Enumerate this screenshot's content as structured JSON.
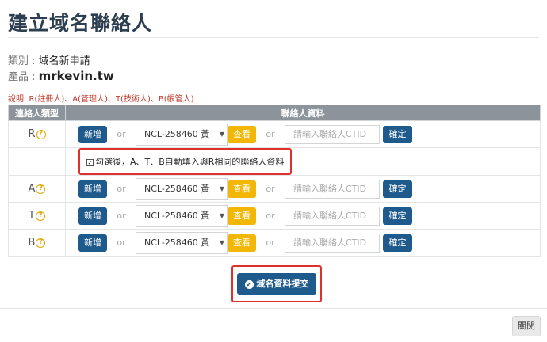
{
  "header": {
    "title": "建立域名聯絡人"
  },
  "meta": {
    "type_label": "類別 : ",
    "type_value": "域名新申請",
    "product_label": "產品 : ",
    "product_value": "mrkevin.tw"
  },
  "note": "說明: R(註冊人)、A(管理人)、T(技術人)、B(帳管人)",
  "table": {
    "col_type": "連絡人類型",
    "col_info": "聯絡人資料",
    "rows": [
      {
        "type": "R"
      },
      {
        "type": "A"
      },
      {
        "type": "T"
      },
      {
        "type": "B"
      }
    ],
    "add_label": "新增",
    "or_label": "or",
    "select_value": "NCL-258460 黃",
    "view_label": "查看",
    "ctid_placeholder": "請輸入聯絡人CTID",
    "confirm_label": "確定",
    "help_glyph": "?"
  },
  "autofill_checkbox": {
    "checked": true,
    "label": "勾選後，A、T、B自動填入與R相同的聯絡人資料"
  },
  "submit": {
    "label": "域名資料提交"
  },
  "footer": {
    "close_label": "關閉"
  },
  "colors": {
    "primary": "#1f5a8c",
    "warning": "#f2b705",
    "highlight_border": "#e0302c",
    "header_bg": "#8c939b"
  }
}
